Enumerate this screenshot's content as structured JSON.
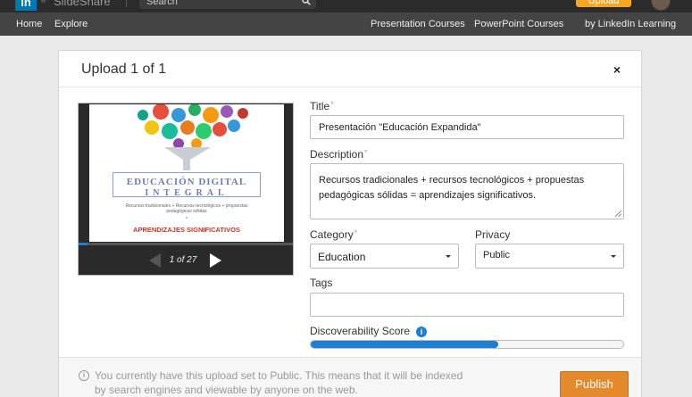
{
  "header": {
    "logo_mark": "in",
    "logo_text": "SlideShare",
    "search_placeholder": "Search",
    "upload_label": "Upload"
  },
  "nav": {
    "left": [
      "Home",
      "Explore"
    ],
    "right": [
      "Presentation Courses",
      "PowerPoint Courses",
      "by LinkedIn Learning"
    ]
  },
  "modal": {
    "title": "Upload 1 of 1",
    "close": "×",
    "preview": {
      "slide_title_line1": "EDUCACIÓN DIGITAL",
      "slide_title_line2": "INTEGRAL",
      "slide_subtitle": "Recursos tradicionales + Recursos tecnológicos + propuestas pedagógicas sólidas",
      "slide_plus": "=",
      "slide_bottom": "APRENDIZAJES SIGNIFICATIVOS",
      "page_indicator": "1 of 27",
      "progress_fraction": 0.04
    },
    "form": {
      "title_label": "Title",
      "title_value": "Presentación \"Educación Expandida\"",
      "description_label": "Description",
      "description_value": "Recursos tradicionales + recursos tecnológicos + propuestas pedagógicas sólidas = aprendizajes significativos.",
      "category_label": "Category",
      "category_value": "Education",
      "privacy_label": "Privacy",
      "privacy_value": "Public",
      "tags_label": "Tags",
      "tags_value": "",
      "score_label": "Discoverability Score",
      "score_fraction": 0.6,
      "required_mark": "*"
    },
    "footer": {
      "message": "You currently have this upload set to Public. This means that it will be indexed by search engines and viewable by anyone on the web.",
      "publish_label": "Publish"
    }
  },
  "colors": {
    "accent_blue": "#1f7ed0",
    "publish_orange": "#e58a2c",
    "nav_bg": "#444444"
  }
}
